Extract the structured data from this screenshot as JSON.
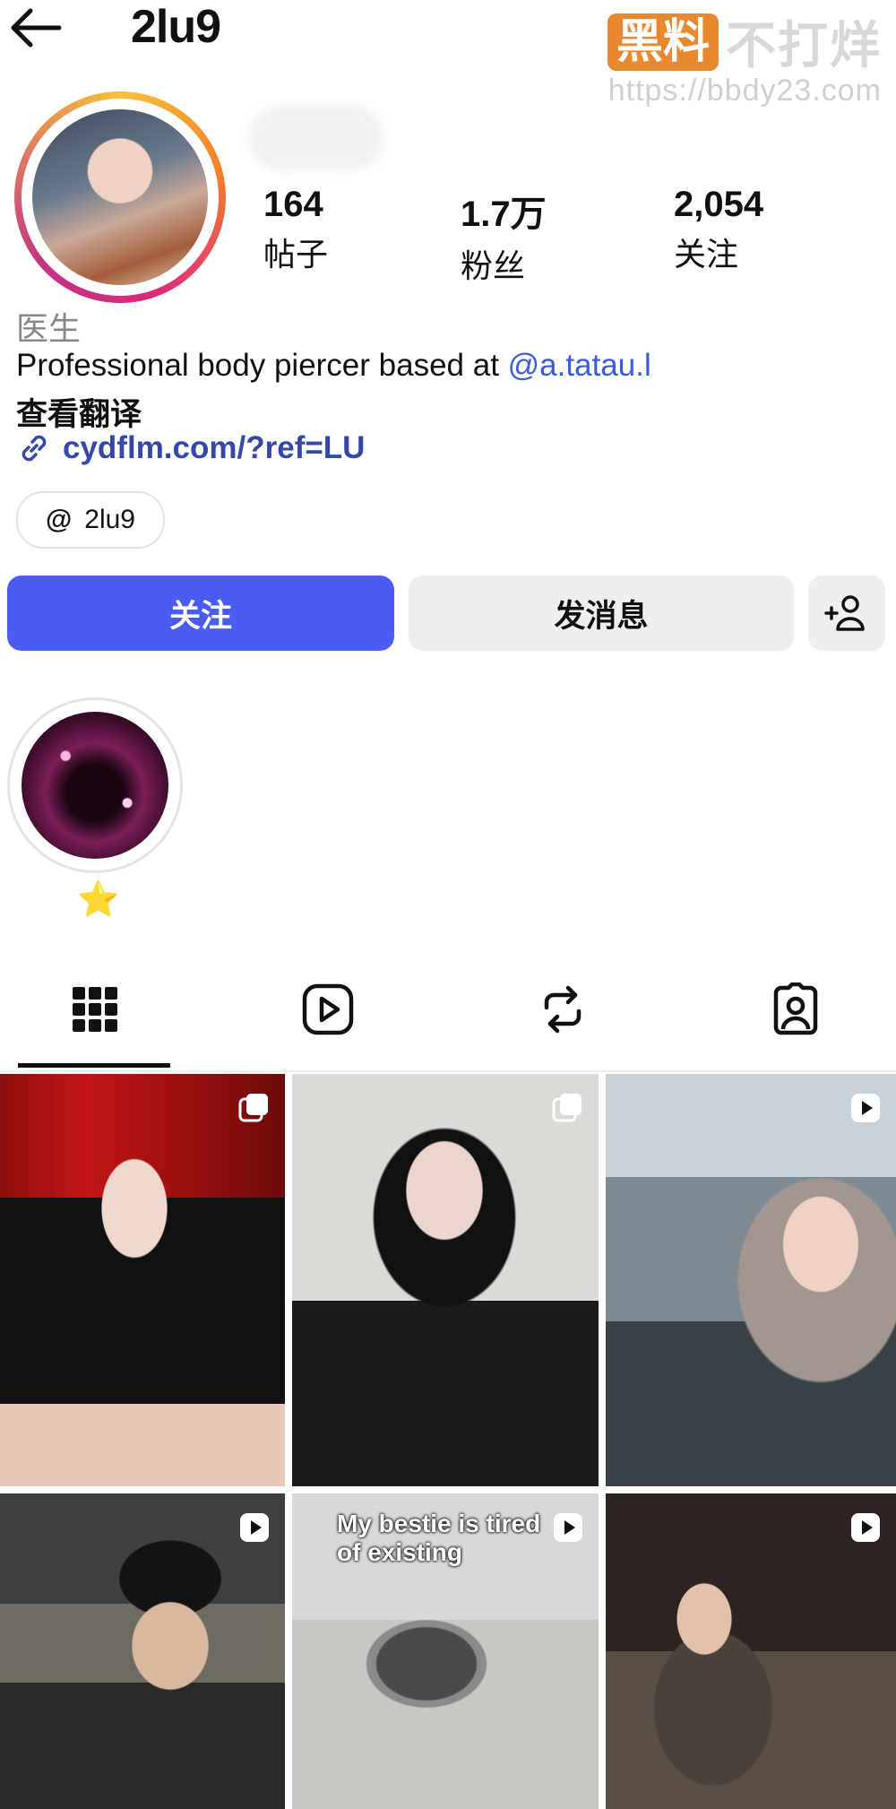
{
  "header": {
    "username": "2lu9"
  },
  "watermark": {
    "badge": "黑料",
    "text": "不打烊",
    "url": "https://bbdy23.com"
  },
  "stats": [
    {
      "value": "164",
      "label": "帖子"
    },
    {
      "value": "1.7万",
      "label": "粉丝"
    },
    {
      "value": "2,054",
      "label": "关注"
    }
  ],
  "profile": {
    "category": "医生",
    "bio_text": "Professional body piercer based at ",
    "bio_mention": "@a.tatau.l",
    "translate": "查看翻译",
    "link": "cydflm.com/?ref=LU",
    "threads_handle": "2lu9"
  },
  "buttons": {
    "follow": "关注",
    "message": "发消息"
  },
  "highlights": [
    {
      "label": "⭐"
    }
  ],
  "tabs": [
    {
      "icon": "grid-icon",
      "active": true
    },
    {
      "icon": "reels-icon",
      "active": false
    },
    {
      "icon": "reposts-icon",
      "active": false
    },
    {
      "icon": "tagged-icon",
      "active": false
    }
  ],
  "posts": [
    {
      "type": "carousel",
      "caption": ""
    },
    {
      "type": "carousel",
      "caption": ""
    },
    {
      "type": "reel",
      "caption": ""
    },
    {
      "type": "reel",
      "caption": ""
    },
    {
      "type": "reel",
      "caption": "My bestie is tired of existing"
    },
    {
      "type": "reel",
      "caption": ""
    }
  ],
  "colors": {
    "accent": "#4a5cf2",
    "link": "#3547a8",
    "mention": "#3c5bd6",
    "watermark": "#e8892f"
  }
}
